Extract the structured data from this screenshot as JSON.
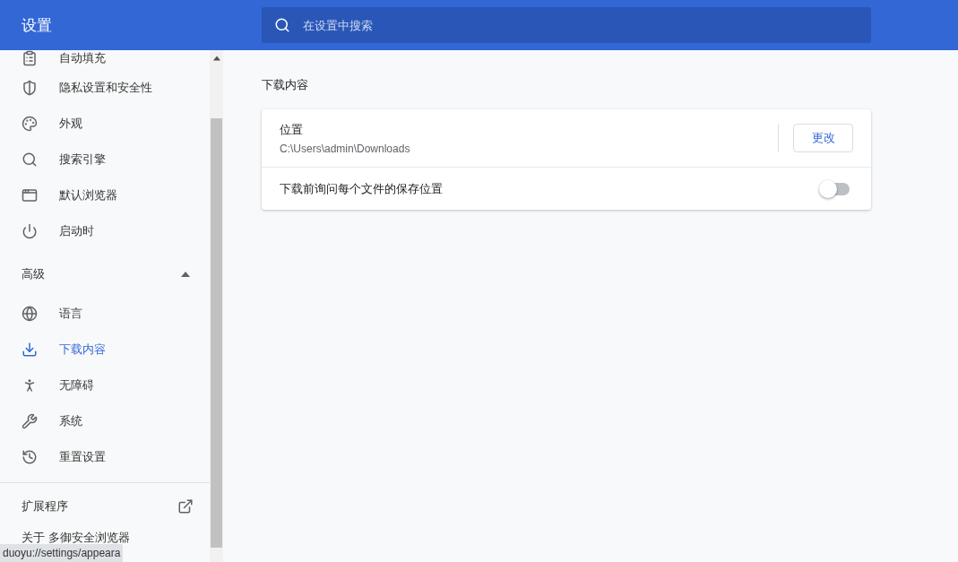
{
  "header": {
    "title": "设置",
    "search": {
      "placeholder": "在设置中搜索"
    }
  },
  "sidebar": {
    "items": [
      {
        "label": "自动填充",
        "selected": false
      },
      {
        "label": "隐私设置和安全性",
        "selected": false
      },
      {
        "label": "外观",
        "selected": false
      },
      {
        "label": "搜索引擎",
        "selected": false
      },
      {
        "label": "默认浏览器",
        "selected": false
      },
      {
        "label": "启动时",
        "selected": false
      }
    ],
    "advanced": {
      "label": "高级",
      "expanded": true,
      "items": [
        {
          "label": "语言",
          "selected": false
        },
        {
          "label": "下载内容",
          "selected": true
        },
        {
          "label": "无障碍",
          "selected": false
        },
        {
          "label": "系统",
          "selected": false
        },
        {
          "label": "重置设置",
          "selected": false
        }
      ]
    },
    "extensions": "扩展程序",
    "about": "关于 多御安全浏览器"
  },
  "section": {
    "title": "下载内容",
    "location": {
      "label": "位置",
      "value": "C:\\Users\\admin\\Downloads",
      "button": "更改"
    },
    "ask": {
      "label": "下载前询问每个文件的保存位置",
      "on": false
    }
  },
  "status_bar": "duoyu://settings/appeara"
}
